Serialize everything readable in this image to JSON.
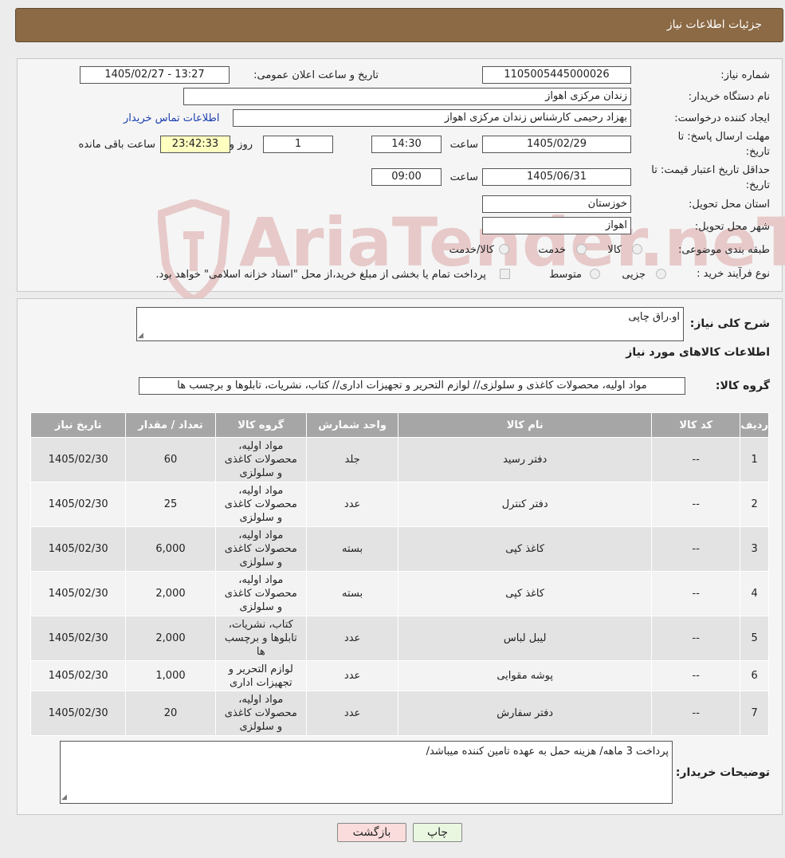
{
  "header": {
    "title": "جزئیات اطلاعات نیاز"
  },
  "form": {
    "need_number_label": "شماره نیاز:",
    "need_number": "1105005445000026",
    "announce_label": "تاریخ و ساعت اعلان عمومی:",
    "announce_value": "1405/02/27 - 13:27",
    "buyer_org_label": "نام دستگاه خریدار:",
    "buyer_org": "زندان مرکزی اهواز",
    "requester_label": "ایجاد کننده درخواست:",
    "requester": "بهزاد رحیمی کارشناس زندان مرکزی اهواز",
    "contact_link": "اطلاعات تماس خریدار",
    "deadline_label_1": "مهلت ارسال پاسخ: تا",
    "deadline_label_2": "تاریخ:",
    "deadline_date": "1405/02/29",
    "time_label": "ساعت",
    "deadline_time": "14:30",
    "days_value": "1",
    "days_label": "روز و",
    "remaining_time": "23:42:33",
    "remaining_label": "ساعت باقی مانده",
    "validity_label_1": "حداقل تاریخ اعتبار قیمت: تا",
    "validity_label_2": "تاریخ:",
    "validity_date": "1405/06/31",
    "validity_time": "09:00",
    "province_label": "استان محل تحویل:",
    "province": "خوزستان",
    "city_label": "شهر محل تحویل:",
    "city": "اهواز",
    "category_label": "طبقه بندی موضوعی:",
    "category_options": [
      "کالا",
      "خدمت",
      "کالا/خدمت"
    ],
    "process_label": "نوع فرآیند خرید :",
    "process_options": [
      "جزیی",
      "متوسط"
    ],
    "process_note": "پرداخت تمام یا بخشی از مبلغ خرید،از محل \"اسناد خزانه اسلامی\" خواهد بود."
  },
  "summary": {
    "desc_label": "شرح کلی نیاز:",
    "desc_value": "او.راق چاپی",
    "goods_title": "اطلاعات کالاهای مورد نیاز",
    "group_label": "گروه کالا:",
    "group_value": "مواد اولیه، محصولات کاغذی و سلولزی// لوازم التحریر و تجهیزات اداری// کتاب، نشریات، تابلوها و برچسب ها"
  },
  "table": {
    "headers": [
      "ردیف",
      "کد کالا",
      "نام کالا",
      "واحد شمارش",
      "گروه کالا",
      "تعداد / مقدار",
      "تاریخ نیاز"
    ],
    "rows": [
      [
        "1",
        "--",
        "دفتر رسید",
        "جلد",
        "مواد اولیه، محصولات کاغذی و سلولزی",
        "60",
        "1405/02/30"
      ],
      [
        "2",
        "--",
        "دفتر کنترل",
        "عدد",
        "مواد اولیه، محصولات کاغذی و سلولزی",
        "25",
        "1405/02/30"
      ],
      [
        "3",
        "--",
        "کاغذ کپی",
        "بسته",
        "مواد اولیه، محصولات کاغذی و سلولزی",
        "6,000",
        "1405/02/30"
      ],
      [
        "4",
        "--",
        "کاغذ کپی",
        "بسته",
        "مواد اولیه، محصولات کاغذی و سلولزی",
        "2,000",
        "1405/02/30"
      ],
      [
        "5",
        "--",
        "لیبل لباس",
        "عدد",
        "کتاب، نشریات، تابلوها و برچسب ها",
        "2,000",
        "1405/02/30"
      ],
      [
        "6",
        "--",
        "پوشه مقوایی",
        "عدد",
        "لوازم التحریر و تجهیزات اداری",
        "1,000",
        "1405/02/30"
      ],
      [
        "7",
        "--",
        "دفتر سفارش",
        "عدد",
        "مواد اولیه، محصولات کاغذی و سلولزی",
        "20",
        "1405/02/30"
      ]
    ]
  },
  "notes": {
    "label": "توضیحات خریدار:",
    "value": "پرداخت 3 ماهه/ هزینه حمل به عهده تامین کننده میباشد/"
  },
  "buttons": {
    "print": "چاپ",
    "back": "بازگشت"
  },
  "watermark": "AriaTender.neT",
  "colors": {
    "header": "#8b6a45",
    "table_header": "#a6a6a6",
    "back_button": "#fbdcdc",
    "print_button": "#e9f7e0",
    "link": "#1a3eb0"
  }
}
